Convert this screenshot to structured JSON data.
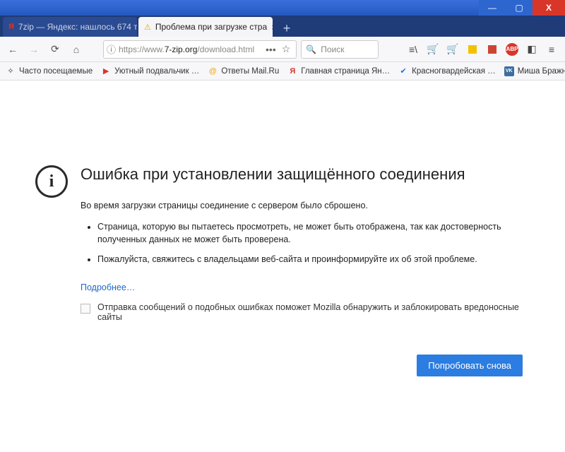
{
  "window": {
    "min": "—",
    "max": "▢",
    "close": "X"
  },
  "tabs": {
    "items": [
      {
        "icon": "Я",
        "icon_color": "#d9362a",
        "label": "7zip — Яндекс: нашлось 674 т",
        "active": false
      },
      {
        "icon": "⚠",
        "icon_color": "#e4a400",
        "label": "Проблема при загрузке стра",
        "active": true
      }
    ],
    "newtab": "+"
  },
  "nav": {
    "back": "←",
    "fwd": "→",
    "reload": "⟳",
    "home": "⌂",
    "lock": "ⓘ",
    "proto_host": "https://www.",
    "domain": "7-zip.org",
    "path": "/download.html",
    "dots": "•••",
    "star": "☆",
    "search_icon": "🔍",
    "search_placeholder": "Поиск"
  },
  "ricons": {
    "lib": "⎙",
    "cart1": "🛒",
    "cart2": "🛒",
    "abp": "ABP",
    "reader": "▭",
    "menu": "≡"
  },
  "bookmarks": {
    "items": [
      {
        "icon": "✧",
        "color": "#666",
        "label": "Часто посещаемые"
      },
      {
        "icon": "▶",
        "color": "#d9362a",
        "label": "Уютный подвальчик …"
      },
      {
        "icon": "@",
        "color": "#f7a400",
        "label": "Ответы Mail.Ru"
      },
      {
        "icon": "Я",
        "color": "#d9362a",
        "label": "Главная страница Ян…"
      },
      {
        "icon": "✔",
        "color": "#1b6feb",
        "label": "Красногвардейская …"
      },
      {
        "icon": "VK",
        "color": "#3b6fa0",
        "label": "Миша Бражников"
      }
    ],
    "overflow": "»"
  },
  "error": {
    "icon": "i",
    "title": "Ошибка при установлении защищённого соединения",
    "lead": "Во время загрузки страницы соединение с сервером было сброшено.",
    "points": [
      "Страница, которую вы пытаетесь просмотреть, не может быть отображена, так как достоверность полученных данных не может быть проверена.",
      "Пожалуйста, свяжитесь с владельцами веб-сайта и проинформируйте их об этой проблеме."
    ],
    "more": "Подробнее…",
    "report": "Отправка сообщений о подобных ошибках поможет Mozilla обнаружить и заблокировать вредоносные сайты",
    "retry": "Попробовать снова"
  }
}
